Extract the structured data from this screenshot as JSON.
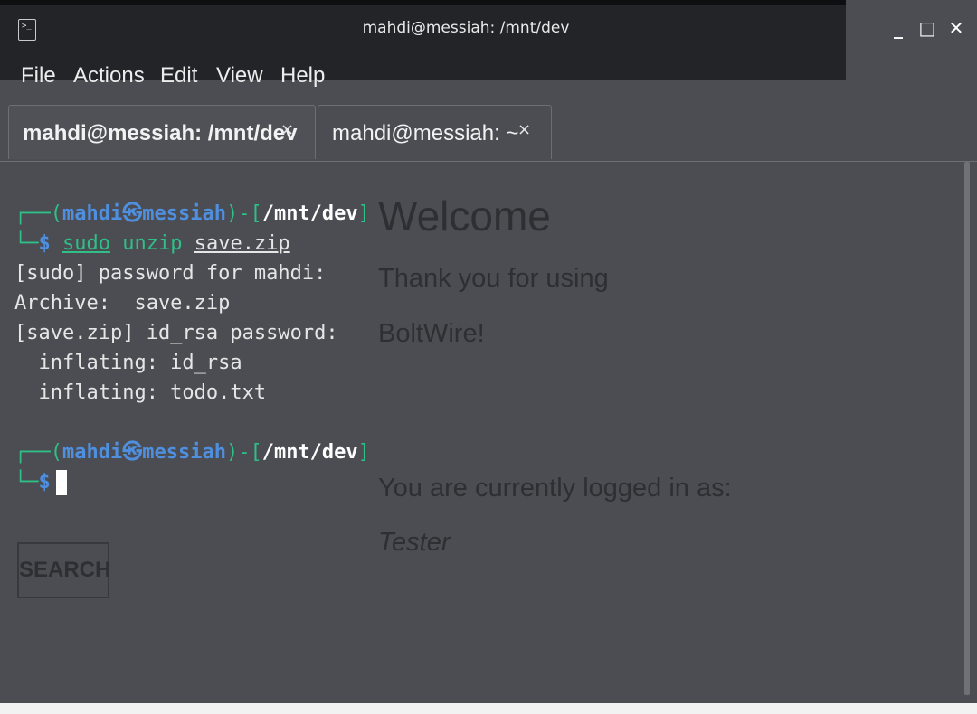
{
  "window": {
    "title": "mahdi@messiah: /mnt/dev",
    "controls": {
      "minimize": "_",
      "maximize": "□",
      "close": "✕"
    }
  },
  "menu": [
    "File",
    "Actions",
    "Edit",
    "View",
    "Help"
  ],
  "tabs": [
    {
      "label": "mahdi@messiah: /mnt/dev",
      "close": "×",
      "active": true
    },
    {
      "label": "mahdi@messiah: ~",
      "close": "×",
      "active": false
    }
  ],
  "terminal": {
    "prompt1": {
      "user": "mahdi",
      "at": "㉿",
      "host": "messiah",
      "path": "/mnt/dev",
      "symbol": "$",
      "cmd": "sudo",
      "cmd2": "unzip",
      "arg": "save.zip"
    },
    "output": [
      "[sudo] password for mahdi:",
      "Archive:  save.zip",
      "[save.zip] id_rsa password:",
      "  inflating: id_rsa",
      "  inflating: todo.txt"
    ],
    "prompt2": {
      "user": "mahdi",
      "at": "㉿",
      "host": "messiah",
      "path": "/mnt/dev",
      "symbol": "$"
    }
  },
  "overlay": {
    "heading": "Welcome",
    "line1": "Thank you for using",
    "line2": "BoltWire!",
    "logged_in": "You are currently logged in as:",
    "user": "Tester",
    "search_button": "SEARCH"
  },
  "colors": {
    "background": "#4b4d53",
    "titlebar": "#232428",
    "prompt_green": "#2fbf87",
    "prompt_blue": "#4f8fe0"
  }
}
